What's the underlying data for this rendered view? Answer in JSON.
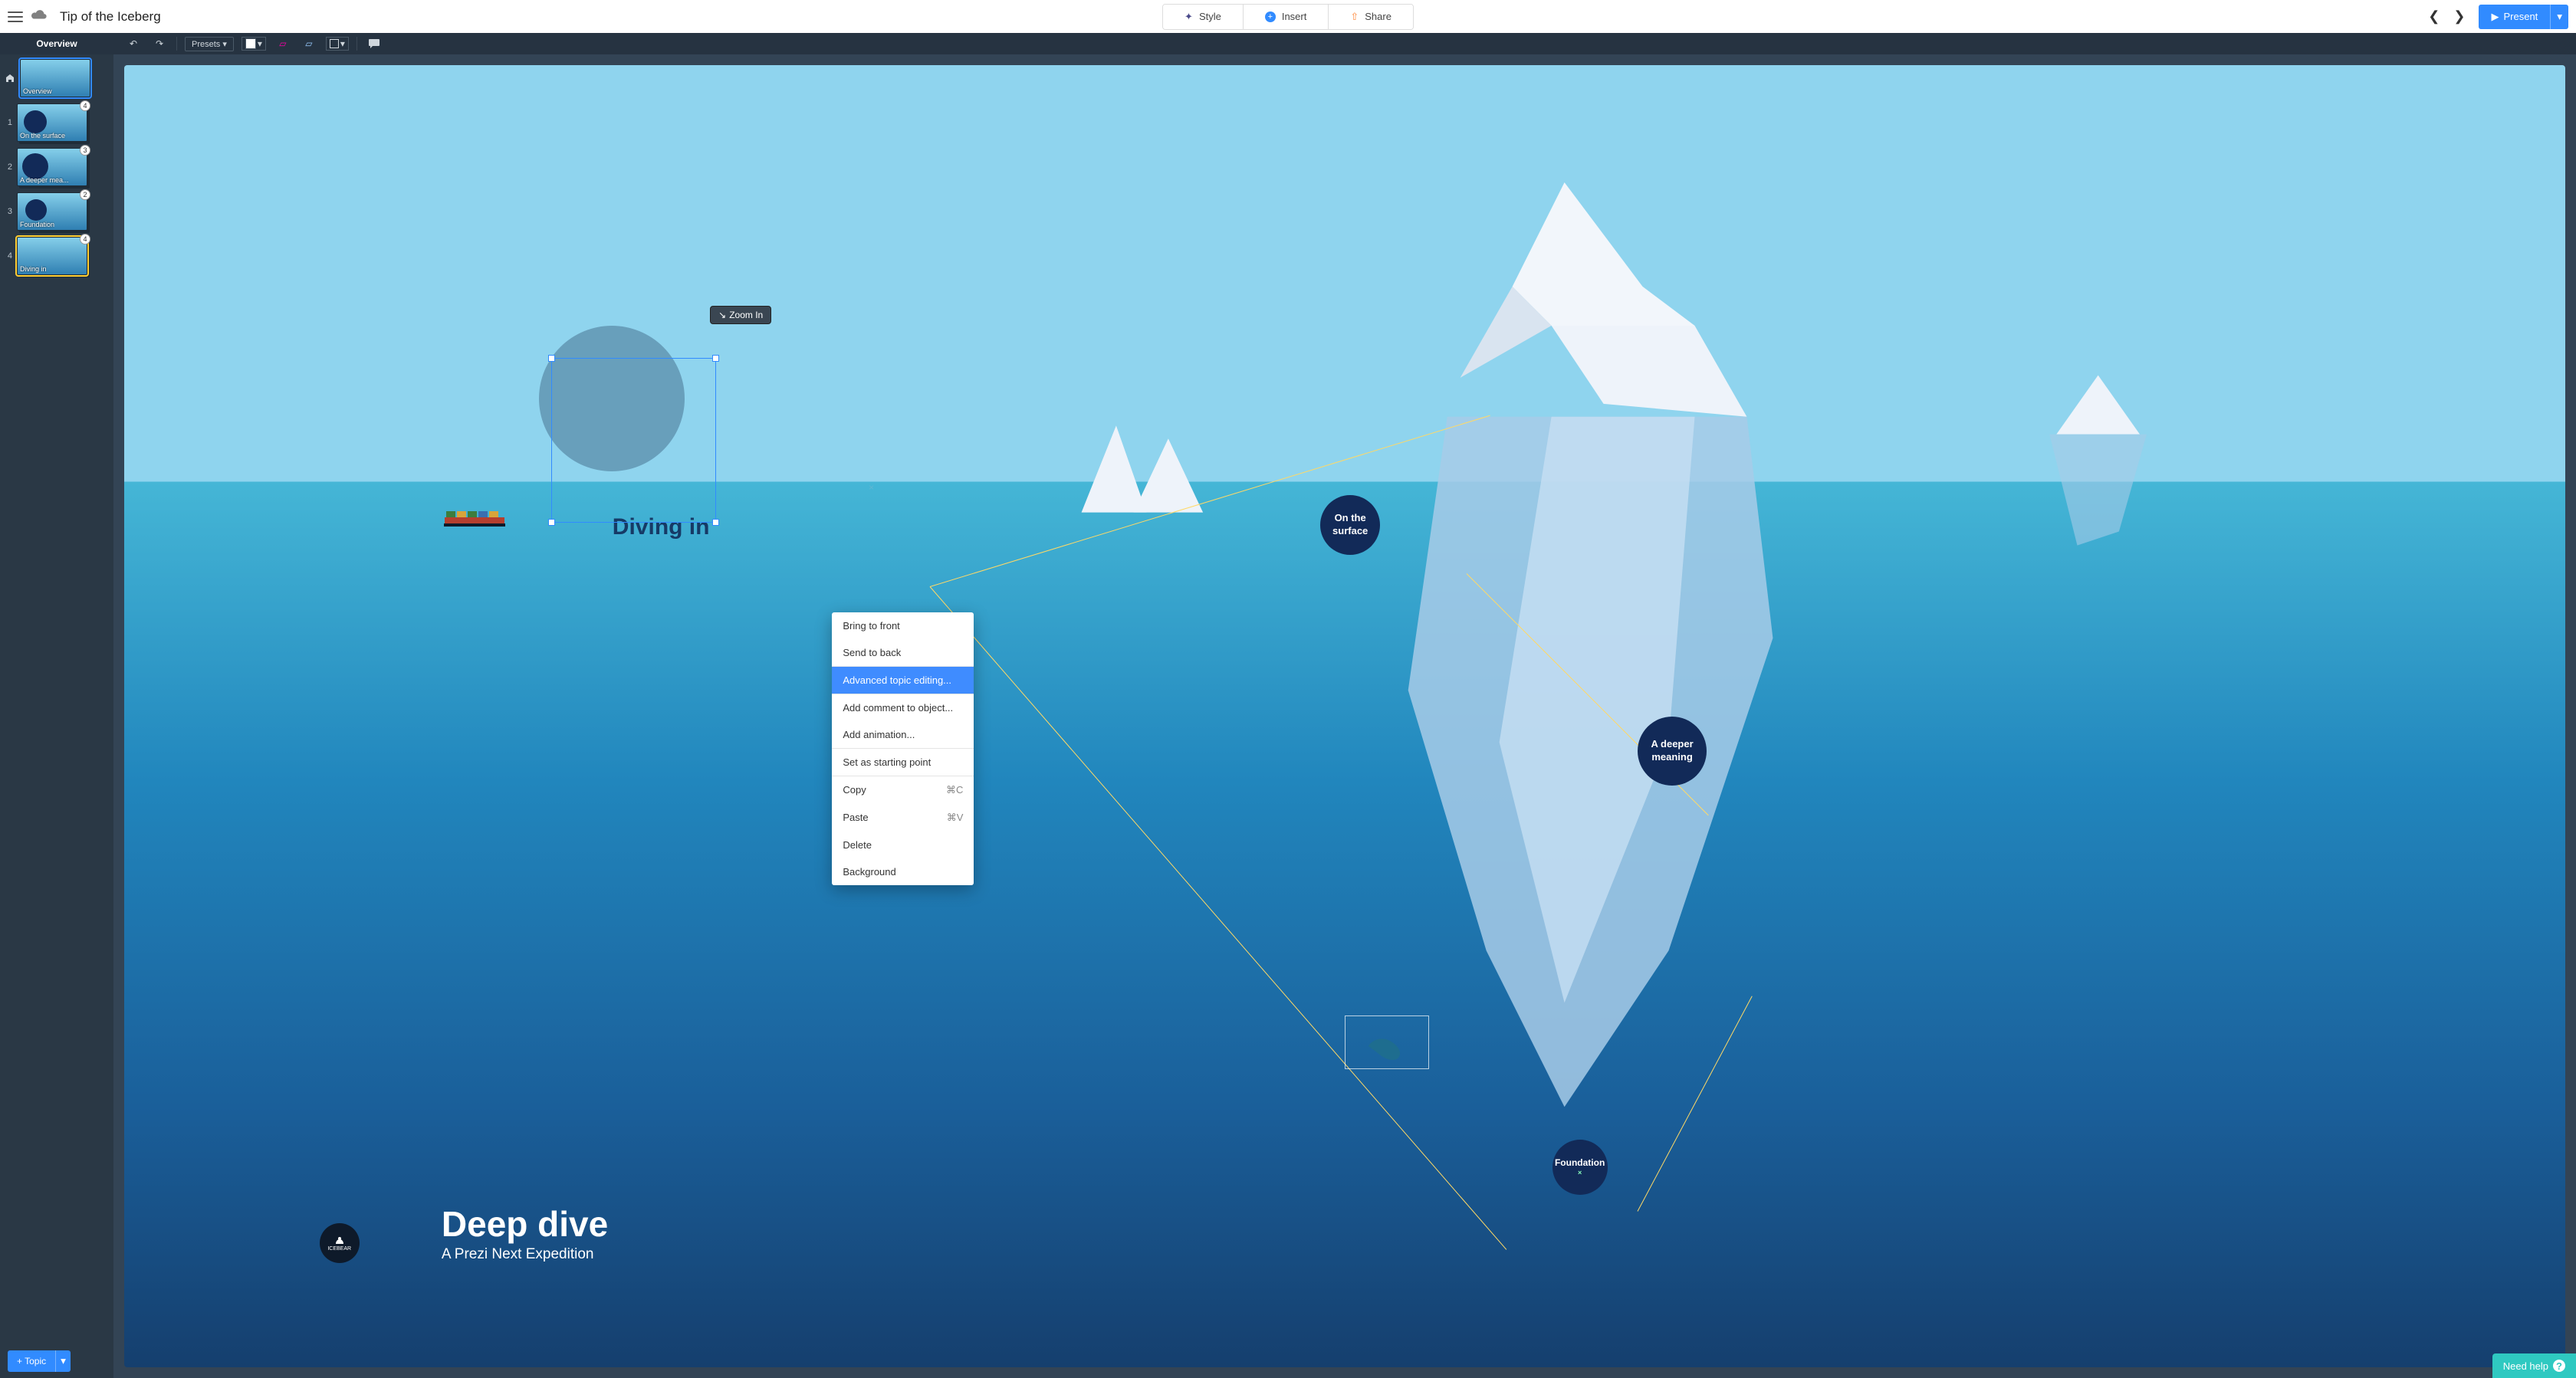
{
  "header": {
    "title": "Tip of the Iceberg",
    "style_label": "Style",
    "insert_label": "Insert",
    "share_label": "Share",
    "present_label": "Present"
  },
  "editbar": {
    "overview_label": "Overview",
    "presets_label": "Presets ▾"
  },
  "sidebar": {
    "add_topic_label": "+ Topic",
    "items": [
      {
        "label": "Overview",
        "badge": ""
      },
      {
        "label": "On the surface",
        "badge": "4"
      },
      {
        "label": "A deeper mea...",
        "badge": "3"
      },
      {
        "label": "Foundation",
        "badge": "2"
      },
      {
        "label": "Diving in",
        "badge": "4"
      }
    ]
  },
  "canvas": {
    "zoom_tooltip": "Zoom In",
    "diving_label": "Diving in",
    "topic_surface_line1": "On the",
    "topic_surface_line2": "surface",
    "topic_deeper_line1": "A deeper",
    "topic_deeper_line2": "meaning",
    "topic_foundation": "Foundation",
    "deep_title": "Deep dive",
    "deep_sub": "A Prezi Next Expedition",
    "logo_text1": "ICEBEAR",
    "need_help": "Need help"
  },
  "context_menu": {
    "bring_front": "Bring to front",
    "send_back": "Send to back",
    "advanced": "Advanced topic editing...",
    "add_comment": "Add comment to object...",
    "add_anim": "Add animation...",
    "start_point": "Set as starting point",
    "copy": "Copy",
    "copy_sc": "⌘C",
    "paste": "Paste",
    "paste_sc": "⌘V",
    "delete": "Delete",
    "background": "Background"
  }
}
